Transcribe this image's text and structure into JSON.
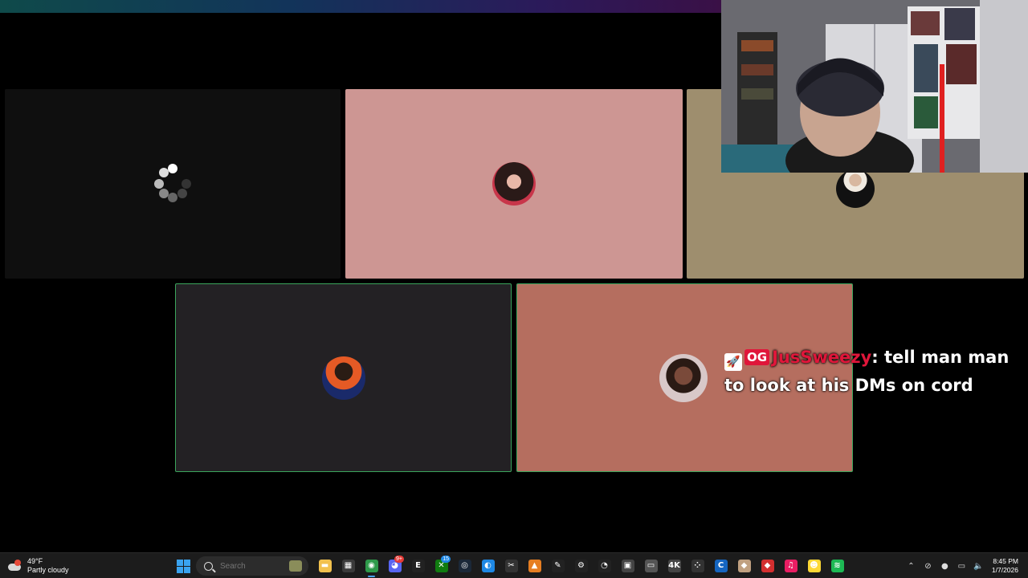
{
  "colors": {
    "speaking_border": "#3ba55c",
    "chat_username": "#e0163a",
    "tile_dark": "#0f0f0f",
    "tile_pink": "#cd9693",
    "tile_tan": "#9e8e6e",
    "tile_charcoal": "#232124",
    "tile_salmon": "#b56e5f"
  },
  "call": {
    "participants": [
      {
        "id": "p1",
        "state": "loading",
        "speaking": false,
        "avatar": "spinner-icon"
      },
      {
        "id": "p2",
        "state": "avatar",
        "speaking": false,
        "avatar": "woman-avatar-icon"
      },
      {
        "id": "p3",
        "state": "avatar",
        "speaking": false,
        "avatar": "tuxedo-avatar-icon"
      },
      {
        "id": "p4",
        "state": "avatar",
        "speaking": true,
        "avatar": "anime-avatar-icon"
      },
      {
        "id": "p5",
        "state": "avatar",
        "speaking": true,
        "avatar": "selfie-avatar-icon"
      }
    ]
  },
  "chat": {
    "badge_icon": "rocket-badge-icon",
    "og_badge": "OG",
    "username": "JusSweezy",
    "separator": ":",
    "message": "tell man man to look at his DMs on cord"
  },
  "taskbar": {
    "weather": {
      "temp": "49°F",
      "condition": "Partly cloudy",
      "icon": "weather-icon"
    },
    "search_placeholder": "Search",
    "apps": [
      {
        "name": "file-explorer",
        "icon": "folder-icon",
        "glyph": "▬",
        "color": "#f2c14e"
      },
      {
        "name": "store",
        "icon": "store-icon",
        "glyph": "▦",
        "color": "#3a3a3a"
      },
      {
        "name": "chrome",
        "icon": "chrome-icon",
        "glyph": "◉",
        "color": "#2e9a4a",
        "active": true
      },
      {
        "name": "discord",
        "icon": "discord-icon",
        "glyph": "◕",
        "color": "#5865f2",
        "badge": "9+"
      },
      {
        "name": "epic-games",
        "icon": "epic-games-icon",
        "glyph": "E",
        "color": "#222"
      },
      {
        "name": "xbox",
        "icon": "xbox-icon",
        "glyph": "✕",
        "color": "#107c10",
        "badge": "15",
        "badge_blue": true
      },
      {
        "name": "steam",
        "icon": "steam-icon",
        "glyph": "◎",
        "color": "#1b2838"
      },
      {
        "name": "app-blue",
        "icon": "blue-app-icon",
        "glyph": "◐",
        "color": "#1e88e5"
      },
      {
        "name": "capcut",
        "icon": "capcut-icon",
        "glyph": "✂",
        "color": "#333"
      },
      {
        "name": "app-orange",
        "icon": "orange-app-icon",
        "glyph": "▲",
        "color": "#e67e22"
      },
      {
        "name": "pen-app",
        "icon": "pen-icon",
        "glyph": "✎",
        "color": "#222"
      },
      {
        "name": "settings",
        "icon": "gear-icon",
        "glyph": "⚙",
        "color": "#222"
      },
      {
        "name": "recorder",
        "icon": "record-icon",
        "glyph": "◔",
        "color": "#222"
      },
      {
        "name": "app-box",
        "icon": "box-app-icon",
        "glyph": "▣",
        "color": "#444"
      },
      {
        "name": "screen-app",
        "icon": "screen-icon",
        "glyph": "▭",
        "color": "#555"
      },
      {
        "name": "video-4k",
        "icon": "4k-video-icon",
        "glyph": "4K",
        "color": "#444"
      },
      {
        "name": "app-dots",
        "icon": "dots-app-icon",
        "glyph": "⁘",
        "color": "#333"
      },
      {
        "name": "ccleaner",
        "icon": "ccleaner-icon",
        "glyph": "C",
        "color": "#1565c0"
      },
      {
        "name": "app-bag",
        "icon": "bag-app-icon",
        "glyph": "◆",
        "color": "#c0a080"
      },
      {
        "name": "app-red",
        "icon": "red-app-icon",
        "glyph": "◆",
        "color": "#d32f2f"
      },
      {
        "name": "music",
        "icon": "music-icon",
        "glyph": "♫",
        "color": "#e91e63"
      },
      {
        "name": "app-yellow",
        "icon": "yellow-app-icon",
        "glyph": "☻",
        "color": "#fdd835"
      },
      {
        "name": "spotify",
        "icon": "spotify-icon",
        "glyph": "≋",
        "color": "#1db954"
      }
    ],
    "tray": [
      {
        "name": "chevron-up-icon",
        "glyph": "⌃"
      },
      {
        "name": "wifi-off-icon",
        "glyph": "⊘"
      },
      {
        "name": "mic-icon",
        "glyph": "●"
      },
      {
        "name": "display-icon",
        "glyph": "▭"
      },
      {
        "name": "volume-icon",
        "glyph": "🔈"
      }
    ],
    "clock": {
      "time": "8:45 PM",
      "date": "1/7/2026"
    }
  }
}
